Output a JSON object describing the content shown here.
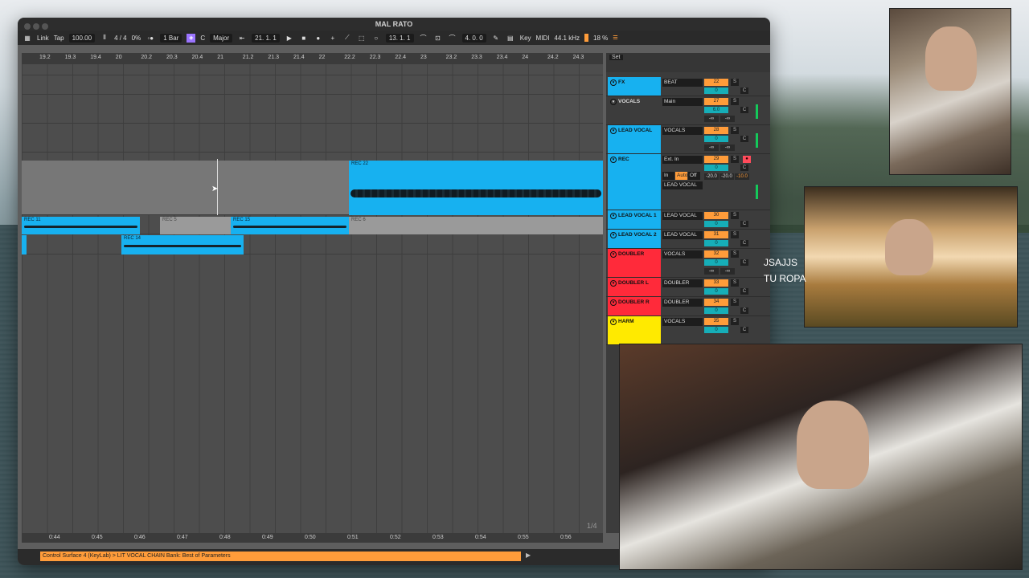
{
  "window": {
    "title": "MAL RATO"
  },
  "control_bar": {
    "link": "Link",
    "tap": "Tap",
    "tempo": "100.00",
    "signature": "4 / 4",
    "swing": "0%",
    "quantize": "1 Bar",
    "key": "C",
    "scale": "Major",
    "position": "21.  1.  1",
    "loop_start": "13.  1.  1",
    "loop_length": "4.  0.  0",
    "key_map": "Key",
    "midi_map": "MIDI",
    "sample_rate": "44.1 kHz",
    "cpu": "18 %"
  },
  "ruler": {
    "ticks": [
      "19.2",
      "19.3",
      "19.4",
      "20",
      "20.2",
      "20.3",
      "20.4",
      "21",
      "21.2",
      "21.3",
      "21.4",
      "22",
      "22.2",
      "22.3",
      "22.4",
      "23",
      "23.2",
      "23.3",
      "23.4",
      "24",
      "24.2",
      "24.3"
    ]
  },
  "clips": {
    "rec22": "REC 22",
    "rec11": "REC 11",
    "rec5": "REC 5",
    "rec15": "REC 15",
    "rec6": "REC 6",
    "rec14": "REC 14"
  },
  "time_ticks": [
    "0:44",
    "0:45",
    "0:46",
    "0:47",
    "0:48",
    "0:49",
    "0:50",
    "0:51",
    "0:52",
    "0:53",
    "0:54",
    "0:55",
    "0:56"
  ],
  "zoom_fraction": "1/4",
  "mixer_header": {
    "set": "Set"
  },
  "mixer": [
    {
      "name": "FX",
      "route": "BEAT",
      "num": "22",
      "pan": "0",
      "color": "#17b1f0"
    },
    {
      "name": "VOCALS",
      "route": "Main",
      "num": "27",
      "pan": "6.0",
      "color": "#3c3c3c"
    },
    {
      "name": "LEAD VOCAL",
      "route": "VOCALS",
      "num": "28",
      "pan": "0",
      "color": "#17b1f0"
    },
    {
      "name": "REC",
      "route": "Ext. In",
      "num": "29",
      "pan": "0",
      "color": "#17b1f0",
      "sub_route": "LEAD VOCAL",
      "monitor_in": "In",
      "monitor_auto": "Auto",
      "monitor_off": "Off"
    },
    {
      "name": "LEAD VOCAL 1",
      "route": "LEAD VOCAL",
      "num": "30",
      "pan": "0",
      "color": "#17b1f0"
    },
    {
      "name": "LEAD VOCAL 2",
      "route": "LEAD VOCAL",
      "num": "31",
      "pan": "0",
      "color": "#17b1f0"
    },
    {
      "name": "DOUBLER",
      "route": "VOCALS",
      "num": "32",
      "pan": "0",
      "color": "#ff2a3a"
    },
    {
      "name": "DOUBLER L",
      "route": "DOUBLER",
      "num": "33",
      "pan": "0",
      "color": "#ff2a3a"
    },
    {
      "name": "DOUBLER R",
      "route": "DOUBLER",
      "num": "34",
      "pan": "0",
      "color": "#ff2a3a"
    },
    {
      "name": "HARM",
      "route": "VOCALS",
      "num": "35",
      "pan": "0",
      "color": "#ffea00"
    }
  ],
  "mixer_labels": {
    "solo": "S",
    "center": "C",
    "neg_inf": "-∞"
  },
  "rec_volumes": [
    "-20.0",
    "-20.0",
    "-10.0"
  ],
  "status": {
    "message": "Control Surface 4 (KeyLab) > LIT VOCAL CHAIN Bank: Best of Parameters"
  },
  "overlay_lyrics": {
    "line1": "JSAJJS",
    "line2": "TU ROPA"
  },
  "colors": {
    "accent": "#ff9c3a",
    "clip_blue": "#17b1f0",
    "scale_purple": "#9b74ff"
  }
}
